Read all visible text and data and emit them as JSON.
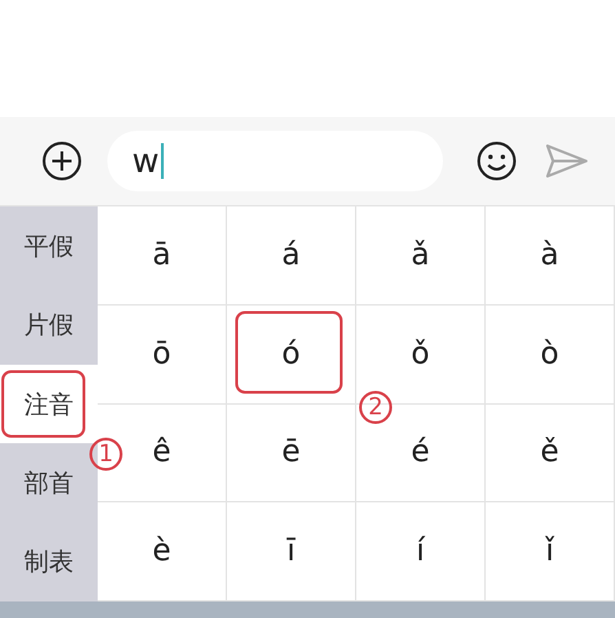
{
  "input": {
    "value": "w"
  },
  "sidebar": {
    "items": [
      {
        "label": "平假",
        "selected": false,
        "highlighted": false
      },
      {
        "label": "片假",
        "selected": false,
        "highlighted": false
      },
      {
        "label": "注音",
        "selected": true,
        "highlighted": true,
        "marker": "1"
      },
      {
        "label": "部首",
        "selected": false,
        "highlighted": false
      },
      {
        "label": "制表",
        "selected": false,
        "highlighted": false
      }
    ]
  },
  "keys": [
    {
      "label": "ā",
      "highlighted": false
    },
    {
      "label": "á",
      "highlighted": false
    },
    {
      "label": "ǎ",
      "highlighted": false
    },
    {
      "label": "à",
      "highlighted": false
    },
    {
      "label": "ō",
      "highlighted": false
    },
    {
      "label": "ó",
      "highlighted": true,
      "marker": "2"
    },
    {
      "label": "ǒ",
      "highlighted": false
    },
    {
      "label": "ò",
      "highlighted": false
    },
    {
      "label": "ê",
      "highlighted": false
    },
    {
      "label": "ē",
      "highlighted": false
    },
    {
      "label": "é",
      "highlighted": false
    },
    {
      "label": "ě",
      "highlighted": false
    },
    {
      "label": "è",
      "highlighted": false
    },
    {
      "label": "ī",
      "highlighted": false
    },
    {
      "label": "í",
      "highlighted": false
    },
    {
      "label": "ǐ",
      "highlighted": false
    }
  ]
}
